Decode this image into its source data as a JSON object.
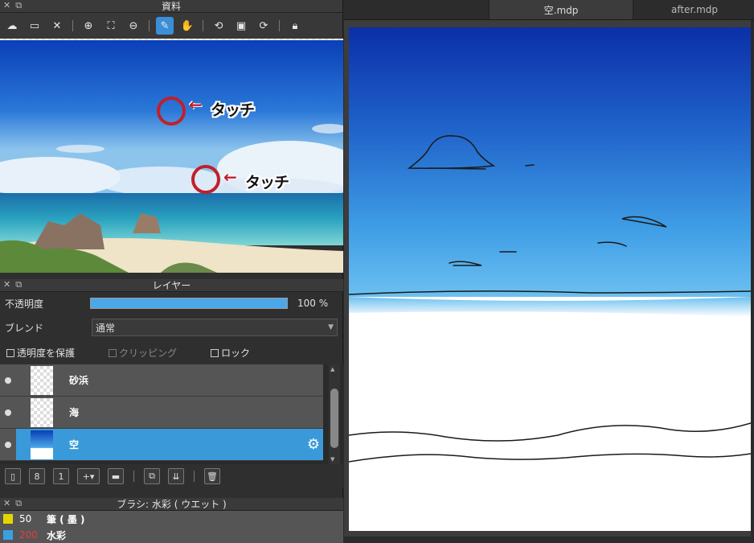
{
  "reference_panel": {
    "title": "資料",
    "toolbar": [
      "open-cloud-icon",
      "folder-icon",
      "close-icon",
      "zoom-in-icon",
      "fit-icon",
      "zoom-out-icon",
      "eyedropper-icon",
      "hand-icon",
      "rotate-left-icon",
      "actual-size-icon",
      "rotate-right-icon",
      "lock-icon"
    ],
    "annotations": [
      {
        "text": "タッチ",
        "arrow": "←"
      },
      {
        "text": "タッチ",
        "arrow": "←"
      }
    ]
  },
  "layer_panel": {
    "title": "レイヤー",
    "opacity_label": "不透明度",
    "opacity_value": "100 %",
    "opacity_fraction": 1.0,
    "blend_label": "ブレンド",
    "blend_value": "通常",
    "protect_alpha": "透明度を保護",
    "clipping": "クリッピング",
    "lock": "ロック",
    "layers": [
      {
        "name": "砂浜",
        "selected": false
      },
      {
        "name": "海",
        "selected": false
      },
      {
        "name": "空",
        "selected": true
      }
    ]
  },
  "brush_panel": {
    "title": "ブラシ: 水彩 ( ウエット )",
    "items": [
      {
        "size": "50",
        "name": "筆 ( 墨 )",
        "color": "#e6d600"
      },
      {
        "size": "200",
        "name": "水彩",
        "color": "#3aa0e0"
      }
    ]
  },
  "tabs": [
    {
      "label": "空.mdp",
      "active": true
    },
    {
      "label": "after.mdp",
      "active": false
    }
  ]
}
